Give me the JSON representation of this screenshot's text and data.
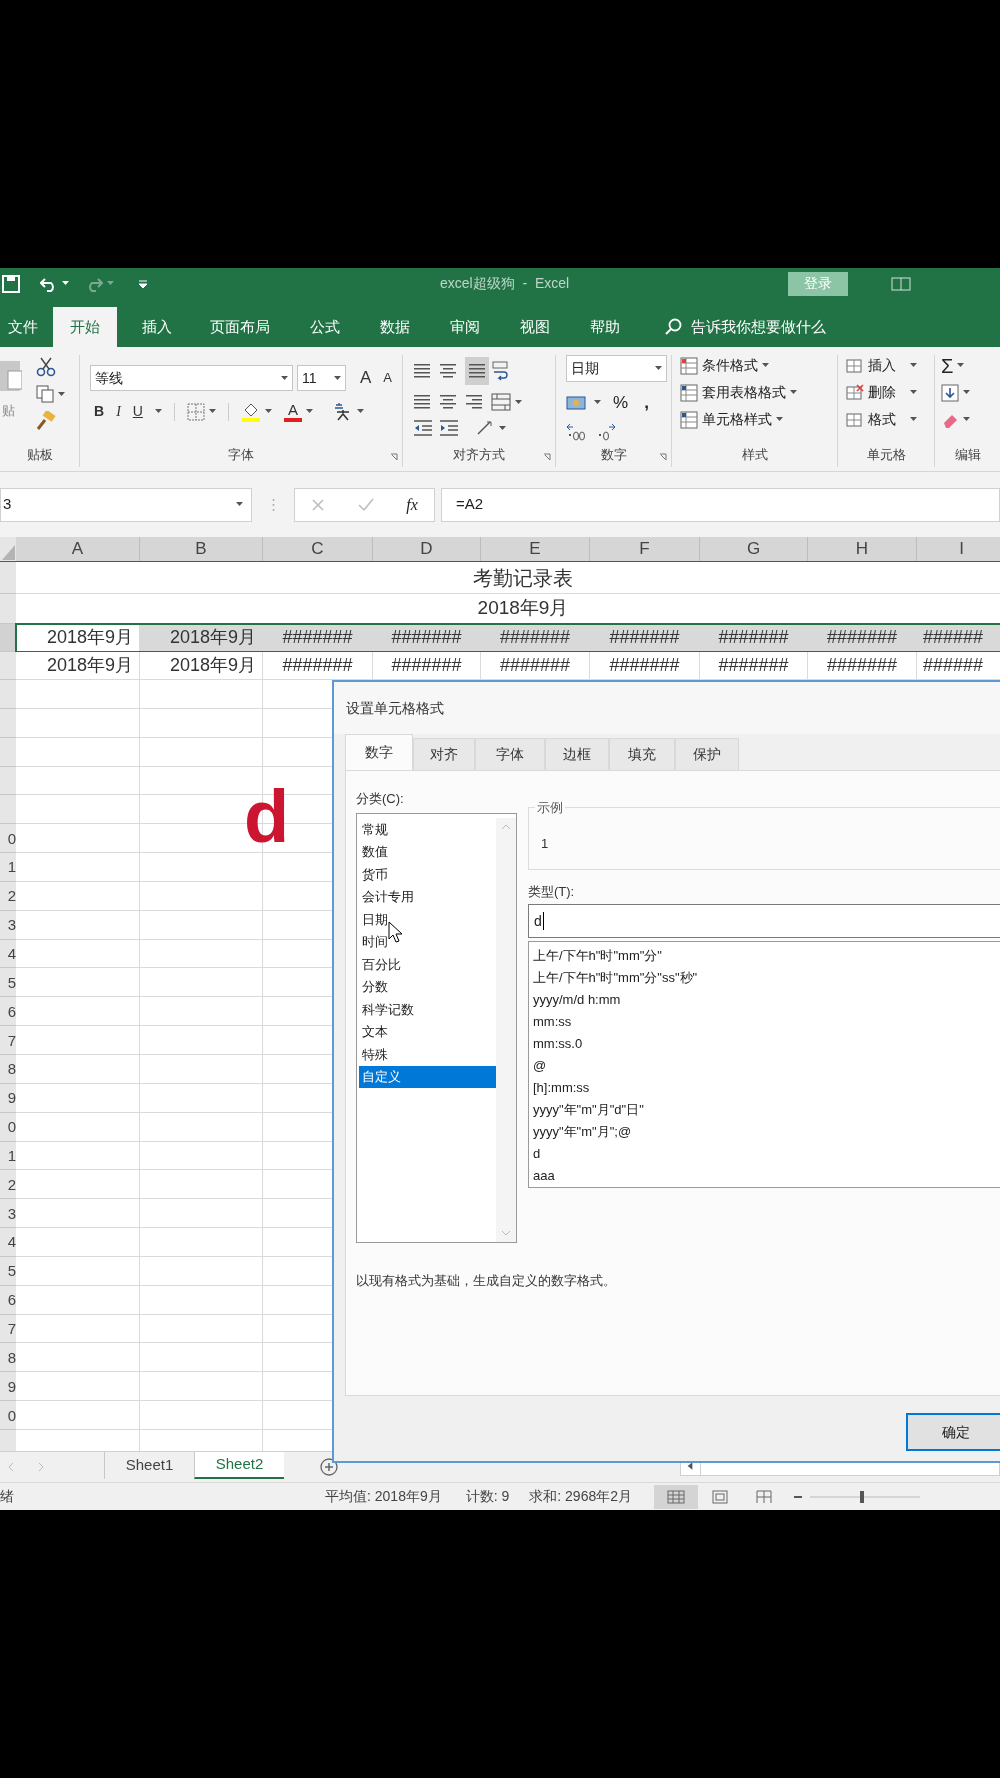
{
  "title_bar": {
    "title": "excel超级狗  -  Excel",
    "sign_in": "登录"
  },
  "ribbon_tabs": [
    {
      "label": "文件",
      "selected": false
    },
    {
      "label": "开始",
      "selected": true
    },
    {
      "label": "插入",
      "selected": false
    },
    {
      "label": "页面布局",
      "selected": false
    },
    {
      "label": "公式",
      "selected": false
    },
    {
      "label": "数据",
      "selected": false
    },
    {
      "label": "审阅",
      "selected": false
    },
    {
      "label": "视图",
      "selected": false
    },
    {
      "label": "帮助",
      "selected": false
    }
  ],
  "tell_me": {
    "placeholder": "告诉我你想要做什么"
  },
  "ribbon": {
    "clipboard": {
      "paste": "贴",
      "label": "贴板"
    },
    "font": {
      "name": "等线",
      "size": "11",
      "grow": "A",
      "shrink": "A",
      "styles": [
        "B",
        "I",
        "U"
      ],
      "color_letter": "A",
      "label": "字体"
    },
    "alignment": {
      "label": "对齐方式"
    },
    "number": {
      "format": "日期",
      "percent": "%",
      "comma": ",",
      "label": "数字"
    },
    "styles": {
      "items": [
        "条件格式",
        "套用表格格式",
        "单元格样式"
      ],
      "label": "样式"
    },
    "cells": {
      "items": [
        "插入",
        "删除",
        "格式"
      ],
      "label": "单元格"
    },
    "editing": {
      "sum": "Σ",
      "label": "编辑"
    }
  },
  "formula_bar": {
    "name_box": "3",
    "fx": "fx",
    "formula": "=A2"
  },
  "sheet": {
    "columns": [
      "A",
      "B",
      "C",
      "D",
      "E",
      "F",
      "G",
      "H",
      "I"
    ],
    "title": "考勤记录表",
    "subtitle": "2018年9月",
    "rows": [
      {
        "selected": true,
        "cells": [
          {
            "text": "2018年9月",
            "selected": false
          },
          {
            "text": "2018年9月",
            "selected": true
          },
          {
            "text": "#######",
            "selected": true
          },
          {
            "text": "#######",
            "selected": true
          },
          {
            "text": "#######",
            "selected": true
          },
          {
            "text": "#######",
            "selected": true
          },
          {
            "text": "#######",
            "selected": true
          },
          {
            "text": "#######",
            "selected": true
          },
          {
            "text": "######",
            "selected": true
          }
        ]
      },
      {
        "selected": false,
        "cells": [
          {
            "text": "2018年9月",
            "selected": false
          },
          {
            "text": "2018年9月",
            "selected": false
          },
          {
            "text": "#######",
            "selected": false
          },
          {
            "text": "#######",
            "selected": false
          },
          {
            "text": "#######",
            "selected": false
          },
          {
            "text": "#######",
            "selected": false
          },
          {
            "text": "#######",
            "selected": false
          },
          {
            "text": "#######",
            "selected": false
          },
          {
            "text": "######",
            "selected": false
          }
        ]
      }
    ],
    "row_numbers": [
      "0",
      "1",
      "2",
      "3",
      "4",
      "5",
      "6",
      "7",
      "8",
      "9",
      "0",
      "1",
      "2",
      "3",
      "4",
      "5",
      "6",
      "7",
      "8",
      "9",
      "0"
    ],
    "overlay_text": "d"
  },
  "dialog": {
    "title": "设置单元格格式",
    "tabs": [
      {
        "label": "数字",
        "selected": true
      },
      {
        "label": "对齐",
        "selected": false
      },
      {
        "label": "字体",
        "selected": false
      },
      {
        "label": "边框",
        "selected": false
      },
      {
        "label": "填充",
        "selected": false
      },
      {
        "label": "保护",
        "selected": false
      }
    ],
    "category_label": "分类(C):",
    "categories": [
      {
        "label": "常规",
        "selected": false
      },
      {
        "label": "数值",
        "selected": false
      },
      {
        "label": "货币",
        "selected": false
      },
      {
        "label": "会计专用",
        "selected": false
      },
      {
        "label": "日期",
        "selected": false
      },
      {
        "label": "时间",
        "selected": false
      },
      {
        "label": "百分比",
        "selected": false
      },
      {
        "label": "分数",
        "selected": false
      },
      {
        "label": "科学记数",
        "selected": false
      },
      {
        "label": "文本",
        "selected": false
      },
      {
        "label": "特殊",
        "selected": false
      },
      {
        "label": "自定义",
        "selected": true
      }
    ],
    "sample_label": "示例",
    "sample": "1",
    "type_label": "类型(T):",
    "type_value": "d",
    "formats": [
      "上午/下午h\"时\"mm\"分\"",
      "上午/下午h\"时\"mm\"分\"ss\"秒\"",
      "yyyy/m/d h:mm",
      "mm:ss",
      "mm:ss.0",
      "@",
      "[h]:mm:ss",
      "yyyy\"年\"m\"月\"d\"日\"",
      "yyyy\"年\"m\"月\";@",
      "d",
      "aaa"
    ],
    "description": "以现有格式为基础，生成自定义的数字格式。",
    "ok": "确定"
  },
  "sheet_tabs": [
    {
      "label": "Sheet1",
      "selected": false
    },
    {
      "label": "Sheet2",
      "selected": true
    }
  ],
  "status_bar": {
    "mode": "绪",
    "average": "平均值: 2018年9月",
    "count": "计数: 9",
    "sum": "求和: 2968年2月",
    "views": [
      {
        "kind": "normal",
        "selected": true
      },
      {
        "kind": "layout",
        "selected": false
      },
      {
        "kind": "pagebreak",
        "selected": false
      }
    ]
  }
}
